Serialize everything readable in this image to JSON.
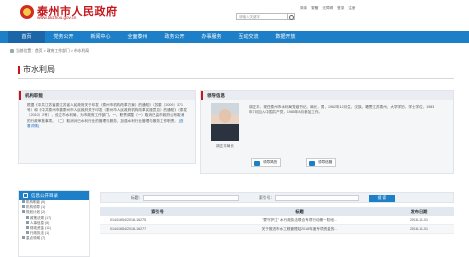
{
  "header": {
    "title": "泰州市人民政府",
    "url": "www.taizhou.gov.cn",
    "search_placeholder": "请输入关键字",
    "top_links": [
      "简体",
      "繁體",
      "无障碍",
      "登录",
      "注册"
    ]
  },
  "nav": {
    "items": [
      "首页",
      "党务公开",
      "新闻中心",
      "全面泰州",
      "政务公开",
      "办事服务",
      "互动交流",
      "数据开放"
    ],
    "active": 0
  },
  "breadcrumb": "当前位置：首页 > 政府工作部门 > 市水利局",
  "section_title": "市水利局",
  "responsibilities": {
    "title": "机构职能",
    "text": "根据《中共江苏省委江苏省人民政府关于印发〈泰州市机构改革方案〉的通知》（苏委〔2009〕371号）和《中共泰州市委泰州市人民政府关于印发〈泰州市人民政府机构改革实施意见〉的通知》（泰发〔2010〕2号），设立市水利局，为市政府工作部门。一、职责调整（一）取消已由市政府公布取消的行政审批事项。（二）取消对已水利行业的管理与服务，加强水利行业管理与服务工作职责。",
    "more": "[查看详情]"
  },
  "leader": {
    "title": "领导信息",
    "caption": "胡正平局长",
    "bio": "胡正平，现任泰州市水利局党组书记、局长，男，1962年12月生，汉族，籍贯江苏泰州，大学学历，学士学位，1983年7月加入中国共产党，1985年8月参加工作。",
    "btn_more": "领导简历",
    "btn_mail": "领导信箱"
  },
  "sidebar": {
    "title": "信息公开目录",
    "items": [
      "机构职能 (5)",
      "机构领导 (1)",
      "规划计划 (2)",
      "政策法规 (17)",
      "人事信息 (5)",
      "财政资金 (11)",
      "行政执法 (1)",
      "重点领域 (7)"
    ]
  },
  "search": {
    "label_title": "标题：",
    "label_index": "索引号：",
    "button": "搜 索"
  },
  "table": {
    "headers": [
      "索引号",
      "标题",
      "发布日期"
    ],
    "rows": [
      {
        "index": "01441654/2018-16275",
        "title": "\"蒙守护江\" 水行政执法联合专项行动第一阶段...",
        "date": "2018-11-01"
      },
      {
        "index": "01441654/2018-16277",
        "title": "关于推进市水工程管理站2018年度专项资金的...",
        "date": "2018-11-01"
      }
    ]
  }
}
